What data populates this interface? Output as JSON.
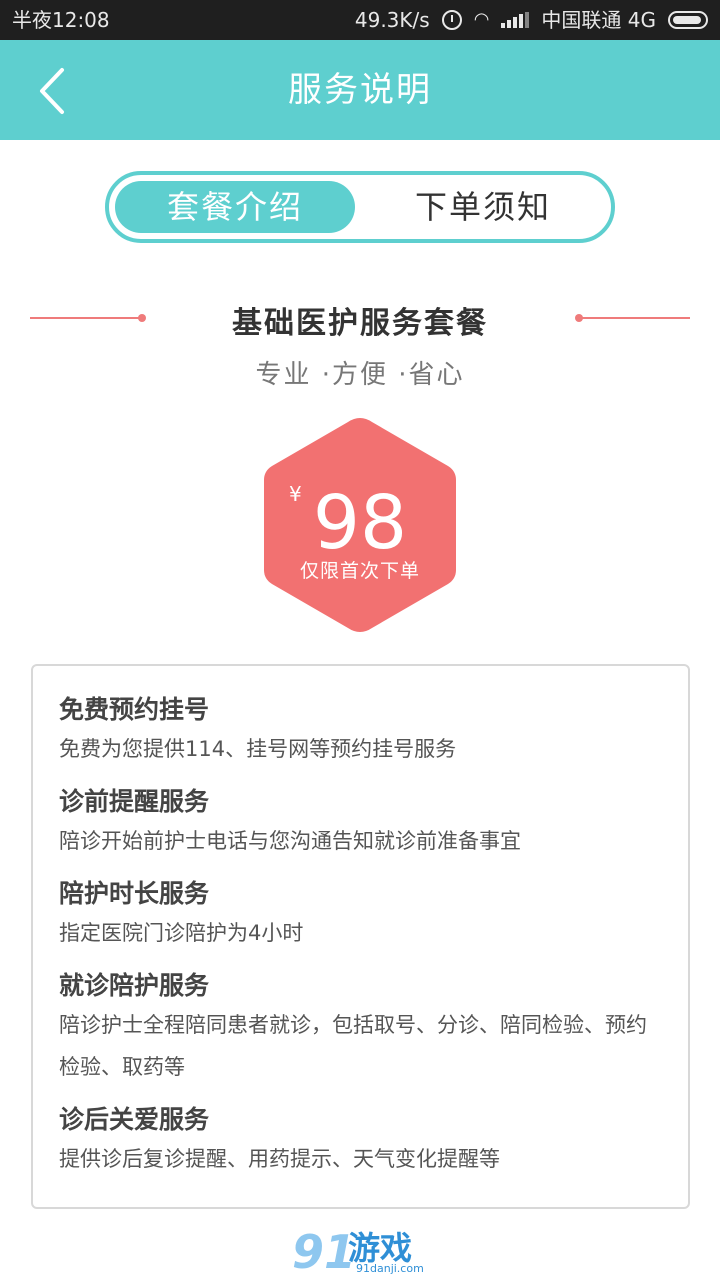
{
  "status_bar": {
    "time": "半夜12:08",
    "network_speed": "49.3K/s",
    "carrier": "中国联通 4G"
  },
  "header": {
    "title": "服务说明",
    "color": "#5ecfcf"
  },
  "tabs": [
    {
      "label": "套餐介绍",
      "active": true
    },
    {
      "label": "下单须知",
      "active": false
    }
  ],
  "package": {
    "title": "基础医护服务套餐",
    "subtitle": "专业 ·方便 ·省心",
    "currency": "¥",
    "price": "98",
    "price_note": "仅限首次下单",
    "accent_color": "#f27171"
  },
  "services": [
    {
      "name": "免费预约挂号",
      "desc": "免费为您提供114、挂号网等预约挂号服务"
    },
    {
      "name": "诊前提醒服务",
      "desc": "陪诊开始前护士电话与您沟通告知就诊前准备事宜"
    },
    {
      "name": "陪护时长服务",
      "desc": "指定医院门诊陪护为4小时"
    },
    {
      "name": "就诊陪护服务",
      "desc": "陪诊护士全程陪同患者就诊，包括取号、分诊、陪同检验、预约检验、取药等"
    },
    {
      "name": "诊后关爱服务",
      "desc": "提供诊后复诊提醒、用药提示、天气变化提醒等"
    }
  ],
  "watermark": {
    "brand": "91",
    "text": "游戏",
    "url": "91danji.com"
  }
}
